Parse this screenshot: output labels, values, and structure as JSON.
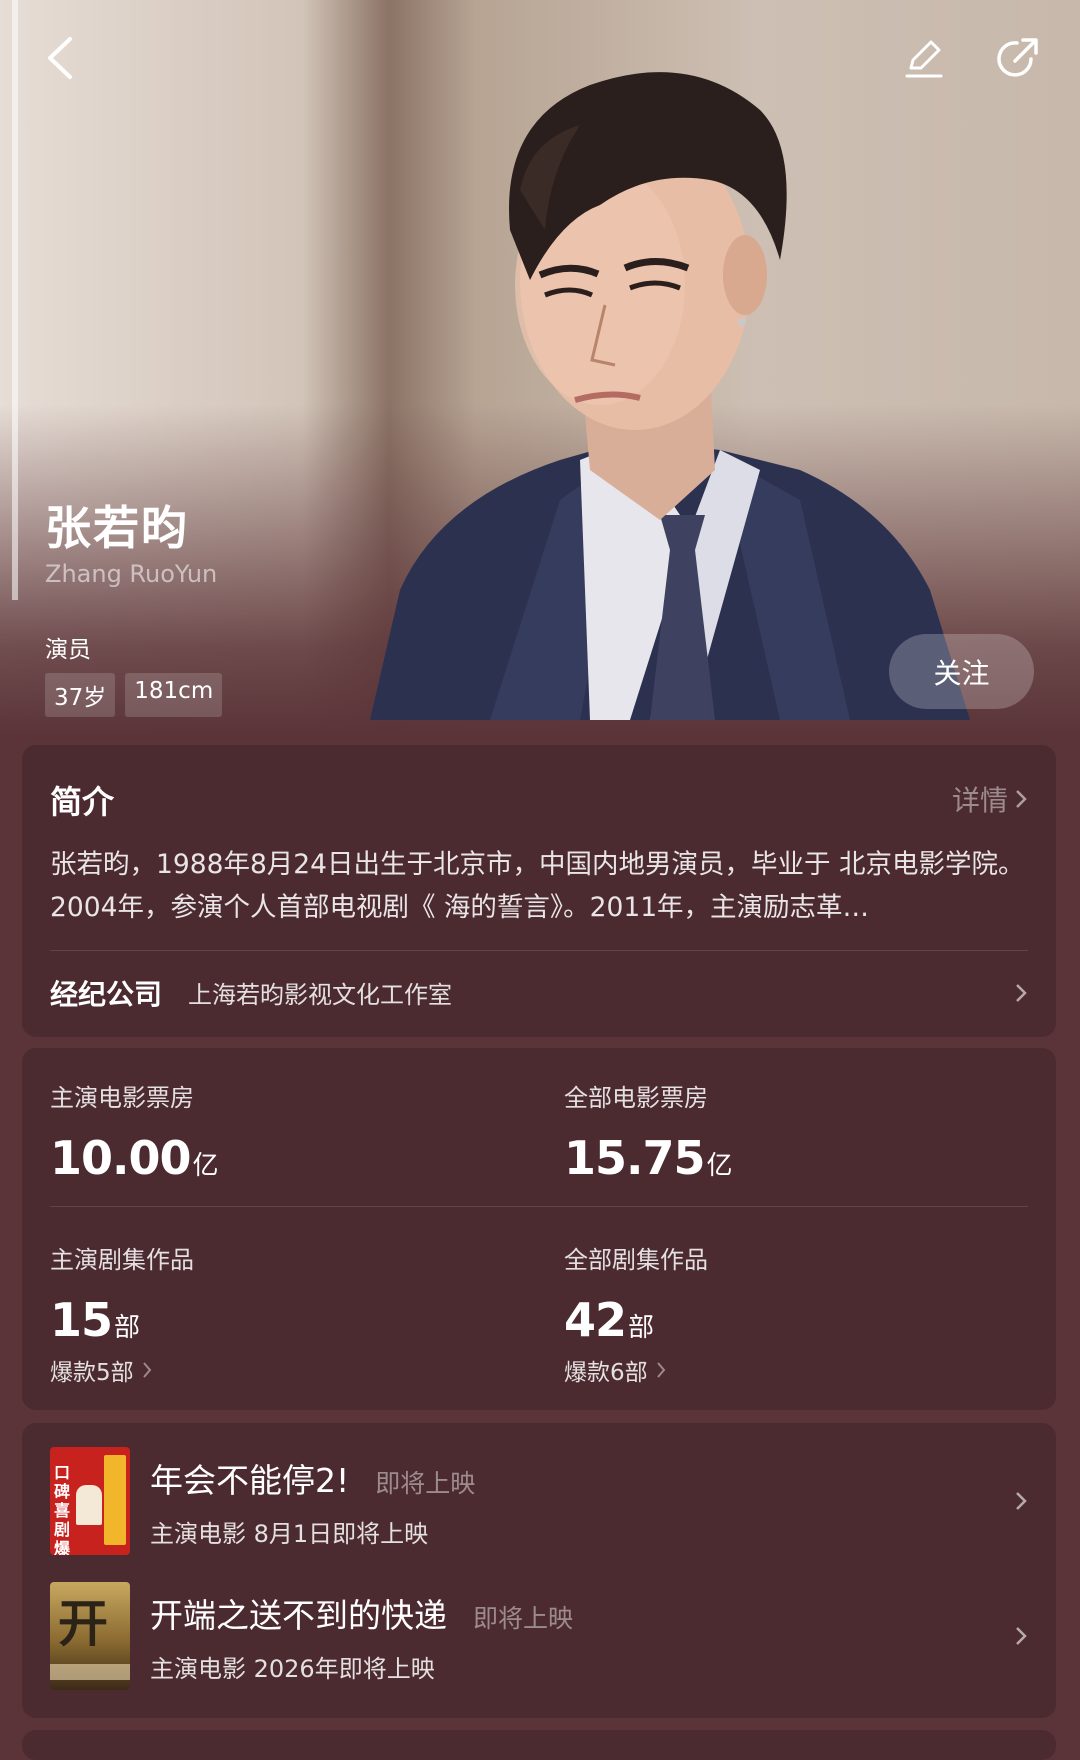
{
  "profile": {
    "name_zh": "张若昀",
    "name_en": "Zhang RuoYun",
    "role": "演员",
    "tags": [
      "37岁",
      "181cm"
    ],
    "follow_label": "关注"
  },
  "bio": {
    "title": "简介",
    "more_label": "详情",
    "text": "张若昀，1988年8月24日出生于北京市，中国内地男演员，毕业于 北京电影学院。 2004年，参演个人首部电视剧《 海的誓言》。2011年，主演励志革…",
    "agency_label": "经纪公司",
    "agency_value": "上海若昀影视文化工作室"
  },
  "stats": {
    "lead_box_office": {
      "label": "主演电影票房",
      "value": "10.00",
      "unit": "亿"
    },
    "total_box_office": {
      "label": "全部电影票房",
      "value": "15.75",
      "unit": "亿"
    },
    "lead_series": {
      "label": "主演剧集作品",
      "value": "15",
      "unit": "部",
      "sub": "爆款5部"
    },
    "total_series": {
      "label": "全部剧集作品",
      "value": "42",
      "unit": "部",
      "sub": "爆款6部"
    }
  },
  "works": [
    {
      "title": "年会不能停2!",
      "status": "即将上映",
      "sub": "主演电影  8月1日即将上映",
      "poster_text": "口碑喜剧 爆笑回归"
    },
    {
      "title": "开端之送不到的快递",
      "status": "即将上映",
      "sub": "主演电影  2026年即将上映",
      "poster_text": "开"
    }
  ],
  "colors": {
    "background": "#5a3438",
    "card": "#4b2b30",
    "poster1": "#c8221e",
    "poster2": "#9a7a3c"
  },
  "icons": [
    "back-icon",
    "edit-icon",
    "share-icon",
    "chevron-right-icon"
  ]
}
